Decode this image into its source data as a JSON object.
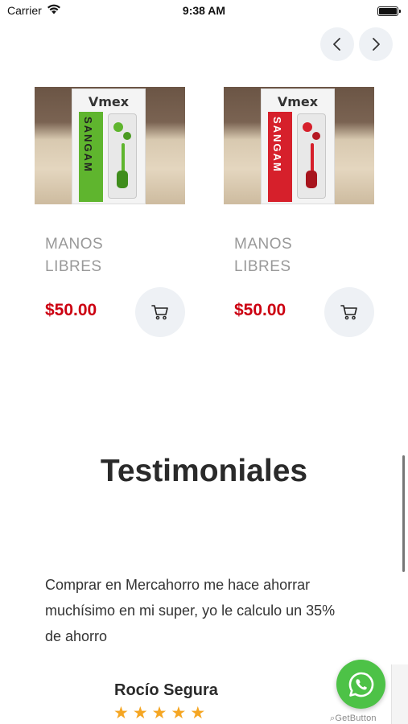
{
  "status_bar": {
    "carrier": "Carrier",
    "time": "9:38 AM",
    "wifi_icon": "wifi-icon",
    "battery_icon": "battery-icon"
  },
  "carousel": {
    "prev_icon": "chevron-left-icon",
    "next_icon": "chevron-right-icon"
  },
  "products": [
    {
      "brand": "Vmex",
      "box_text": "SANGAM",
      "name": "MANOS LIBRES",
      "price": "$50.00",
      "accent": "#5fb52e",
      "cart_icon": "cart-icon"
    },
    {
      "brand": "Vmex",
      "box_text": "SANGAM",
      "name": "MANOS LIBRES",
      "price": "$50.00",
      "accent": "#d6202b",
      "cart_icon": "cart-icon"
    }
  ],
  "testimonials": {
    "title": "Testimoniales",
    "quote": "Comprar en Mercahorro me hace ahorrar muchísimo en mi super, yo le calculo un 35% de ahorro",
    "author": "Rocío Segura",
    "rating": 5
  },
  "whatsapp": {
    "icon": "whatsapp-icon",
    "credit": "GetButton"
  },
  "colors": {
    "price": "#cc0011",
    "button_bg": "#eef1f5",
    "star": "#f5a623",
    "whatsapp": "#4dc247"
  }
}
